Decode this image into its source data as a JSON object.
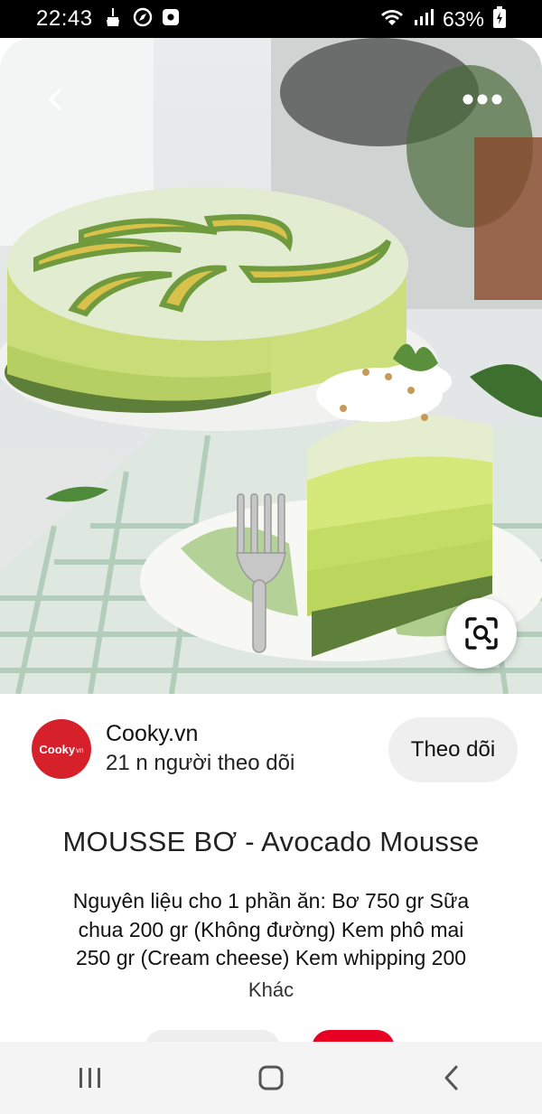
{
  "status_bar": {
    "time": "22:43",
    "battery": "63%",
    "icons": [
      "broom-icon",
      "compass-icon",
      "screen-record-icon",
      "wifi-icon",
      "signal-icon",
      "battery-charging-icon"
    ]
  },
  "hero": {
    "back_icon": "chevron-left-icon",
    "more_icon": "more-dots-icon",
    "visual_search_icon": "visual-search-icon"
  },
  "publisher": {
    "avatar_text": "Cooky",
    "avatar_suffix": "vn",
    "name": "Cooky.vn",
    "followers": "21 n người theo dõi",
    "follow_label": "Theo dõi"
  },
  "pin": {
    "title": "MOUSSE BƠ - Avocado Mousse",
    "description": "Nguyên liệu cho 1 phần ăn:   Bơ 750 gr  Sữa\nchua 200 gr (Không đường)  Kem phô mai\n250 gr (Cream cheese)  Kem whipping 200",
    "more": "Khác"
  },
  "nav": {
    "recents_icon": "recent-apps-icon",
    "home_icon": "home-icon",
    "back_icon": "back-icon"
  },
  "colors": {
    "brand_red": "#d6202a",
    "save_red": "#e60023",
    "mousse_green": "#c9e07a",
    "matcha": "#6f9a4a"
  }
}
